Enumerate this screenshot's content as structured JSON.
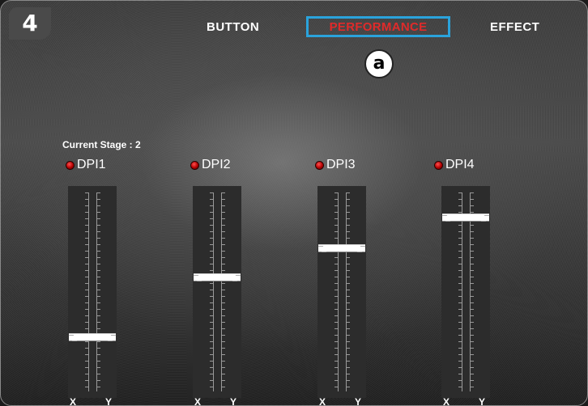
{
  "badge": {
    "text": "4"
  },
  "tabs": {
    "button": "BUTTON",
    "performance": "PERFORMANCE",
    "effect": "EFFECT"
  },
  "marker": {
    "text": "a"
  },
  "stage": {
    "label": "Current Stage : 2"
  },
  "dpi_stages": [
    {
      "label": "DPI1",
      "level": 0.25,
      "x_label": "X",
      "y_label": "Y"
    },
    {
      "label": "DPI2",
      "level": 0.58,
      "x_label": "X",
      "y_label": "Y"
    },
    {
      "label": "DPI3",
      "level": 0.74,
      "x_label": "X",
      "y_label": "Y"
    },
    {
      "label": "DPI4",
      "level": 0.91,
      "x_label": "X",
      "y_label": "Y"
    }
  ],
  "colors": {
    "active_tab": "#e02a2a",
    "highlight_border": "#2aa3dc",
    "indicator": "#b30000"
  }
}
